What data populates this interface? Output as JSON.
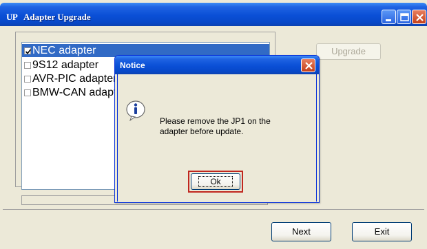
{
  "window": {
    "logo_text": "UP",
    "title": "Adapter Upgrade",
    "controls": {
      "minimize_icon": "minimize-icon",
      "maximize_icon": "maximize-icon",
      "close_icon": "close-icon"
    }
  },
  "adapter_list": {
    "items": [
      {
        "label": "NEC adapter",
        "checked": true,
        "selected": true
      },
      {
        "label": "9S12 adapter",
        "checked": false,
        "selected": false
      },
      {
        "label": "AVR-PIC adapter",
        "checked": false,
        "selected": false
      },
      {
        "label": "BMW-CAN adapter",
        "checked": false,
        "selected": false
      }
    ]
  },
  "progress": {
    "value": 0
  },
  "buttons": {
    "upgrade": "Upgrade",
    "upgrade_enabled": false,
    "next": "Next",
    "exit": "Exit"
  },
  "dialog": {
    "title": "Notice",
    "icon": "info-icon",
    "message": "Please remove the JP1 on the adapter before update.",
    "ok_label": "Ok"
  },
  "colors": {
    "titlebar": "#0a4fd6",
    "selection": "#316ac5",
    "window_face": "#ece9d8",
    "highlight_border": "#c0261e"
  }
}
